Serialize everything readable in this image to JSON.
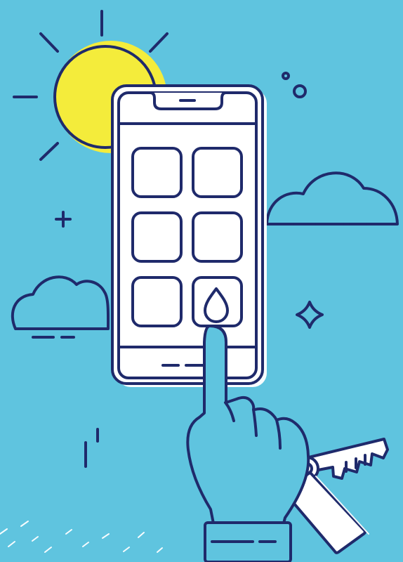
{
  "scene": {
    "description": "",
    "colors": {
      "background": "#5fc4df",
      "outline": "#1f2a6b",
      "sun": "#f4ec3b",
      "white": "#ffffff"
    },
    "icons": [
      "sun-icon",
      "smartphone-icon",
      "app-tile-icon",
      "water-drop-icon",
      "pointing-hand-icon",
      "key-icon",
      "key-tag-icon",
      "cloud-icon",
      "sparkle-icon",
      "plus-icon",
      "circle-icon"
    ]
  }
}
